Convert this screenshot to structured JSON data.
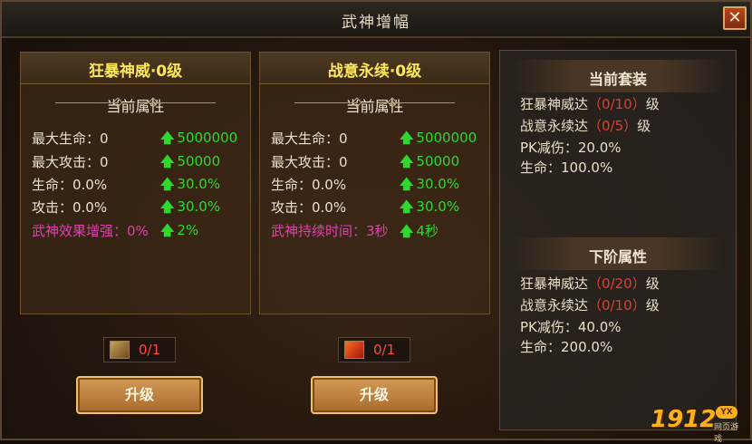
{
  "window": {
    "title": "武神增幅",
    "close_glyph": "✕"
  },
  "panels": [
    {
      "title": "狂暴神威·0级",
      "subtitle": "当前属性",
      "rows": [
        {
          "label": "最大生命：0",
          "value": "5000000"
        },
        {
          "label": "最大攻击：0",
          "value": "50000"
        },
        {
          "label": "生命：0.0%",
          "value": "30.0%"
        },
        {
          "label": "攻击：0.0%",
          "value": "30.0%"
        },
        {
          "label": "武神效果增强：0%",
          "value": "2%"
        }
      ],
      "item_count": "0/1",
      "button": "升级"
    },
    {
      "title": "战意永续·0级",
      "subtitle": "当前属性",
      "rows": [
        {
          "label": "最大生命：0",
          "value": "5000000"
        },
        {
          "label": "最大攻击：0",
          "value": "50000"
        },
        {
          "label": "生命：0.0%",
          "value": "30.0%"
        },
        {
          "label": "攻击：0.0%",
          "value": "30.0%"
        },
        {
          "label": "武神持续时间：3秒",
          "value": "4秒"
        }
      ],
      "item_count": "0/1",
      "button": "升级"
    }
  ],
  "current_set": {
    "title": "当前套装",
    "line1": {
      "prefix": "狂暴神威达",
      "progress": "（0/10）",
      "suffix": "级"
    },
    "line2": {
      "prefix": "战意永续达",
      "progress": "（0/5）",
      "suffix": "级"
    },
    "line3": "PK减伤：20.0%",
    "line4": "生命：100.0%"
  },
  "next_set": {
    "title": "下阶属性",
    "line1": {
      "prefix": "狂暴神威达",
      "progress": "（0/20）",
      "suffix": "级"
    },
    "line2": {
      "prefix": "战意永续达",
      "progress": "（0/10）",
      "suffix": "级"
    },
    "line3": "PK减伤：40.0%",
    "line4": "生命：200.0%"
  },
  "watermark": {
    "number": "1912",
    "badge": "YX",
    "caption": "网页游戏"
  },
  "colors": {
    "title_yellow": "#ffe85a",
    "bonus_green": "#2fd82f",
    "special_pink": "#e040b0",
    "progress_red": "#e04030"
  },
  "icons": [
    "close-icon",
    "up-arrow-icon",
    "scroll-item-icon",
    "red-book-item-icon"
  ]
}
